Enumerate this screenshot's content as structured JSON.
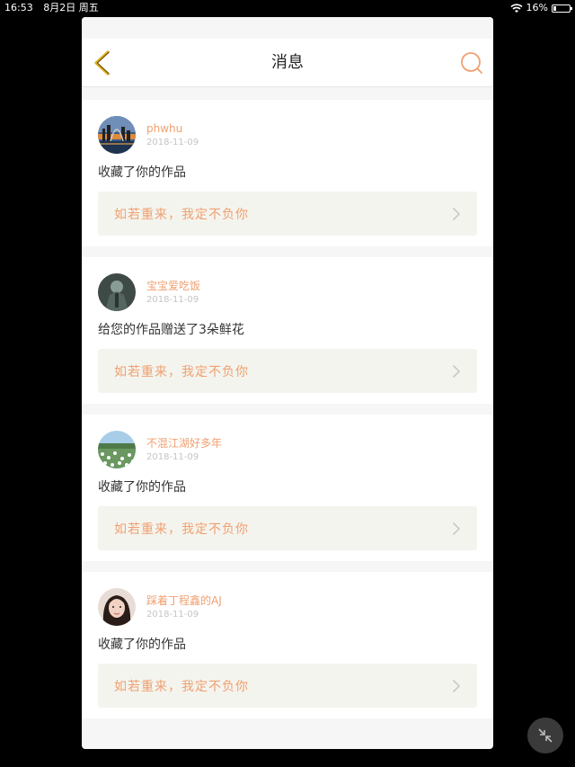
{
  "status_bar": {
    "time": "16:53",
    "date": "8月2日 周五",
    "battery": "16%",
    "battery_level": 0.16
  },
  "header": {
    "title": "消息",
    "back_icon": "chevron-left-icon",
    "search_icon": "search-icon"
  },
  "colors": {
    "accent": "#f0a070",
    "back_icon": "#e0b020"
  },
  "messages": [
    {
      "username": "phwhu",
      "date": "2018-11-09",
      "text": "收藏了你的作品",
      "work_title": "如若重来，我定不负你",
      "avatar": "city-skyline-avatar"
    },
    {
      "username": "宝宝爱吃饭",
      "date": "2018-11-09",
      "text": "给您的作品赠送了3朵鲜花",
      "work_title": "如若重来，我定不负你",
      "avatar": "game-character-avatar"
    },
    {
      "username": "不混江湖好多年",
      "date": "2018-11-09",
      "text": "收藏了你的作品",
      "work_title": "如若重来，我定不负你",
      "avatar": "flower-field-avatar"
    },
    {
      "username": "踩着丁程鑫的AJ",
      "date": "2018-11-09",
      "text": "收藏了你的作品",
      "work_title": "如若重来，我定不负你",
      "avatar": "girl-portrait-avatar"
    }
  ],
  "floating_button_icon": "collapse-arrows-icon"
}
